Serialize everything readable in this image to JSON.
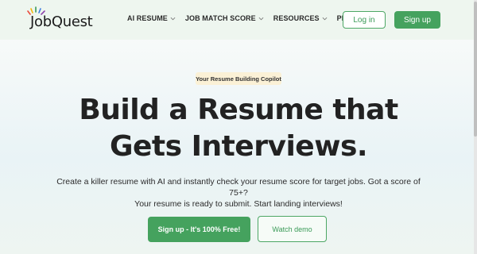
{
  "brand": {
    "name": "JobQuest",
    "colors": {
      "accent": "#45a25e",
      "accent_dark": "#3a9a57",
      "header_bg": "#eef6ef",
      "badge_bg": "#fbf1d6"
    }
  },
  "nav": {
    "items": [
      {
        "label": "AI RESUME",
        "has_dropdown": true
      },
      {
        "label": "JOB MATCH SCORE",
        "has_dropdown": true
      },
      {
        "label": "RESOURCES",
        "has_dropdown": true
      },
      {
        "label": "PRICING",
        "has_dropdown": false
      }
    ],
    "login_label": "Log in",
    "signup_label": "Sign up"
  },
  "hero": {
    "badge": "Your Resume Building Copilot",
    "headline_line1": "Build a Resume that",
    "headline_line2": "Gets Interviews.",
    "subtext_line1": "Create a killer resume with AI and instantly check your resume score for target jobs. Got a score of 75+?",
    "subtext_line2": "Your resume is ready to submit. Start landing interviews!",
    "cta_primary": "Sign up - It's 100% Free!",
    "cta_secondary": "Watch demo"
  },
  "icons": {
    "dropdown": "chevron-down-icon",
    "logo_rays": "sunburst-icon"
  }
}
